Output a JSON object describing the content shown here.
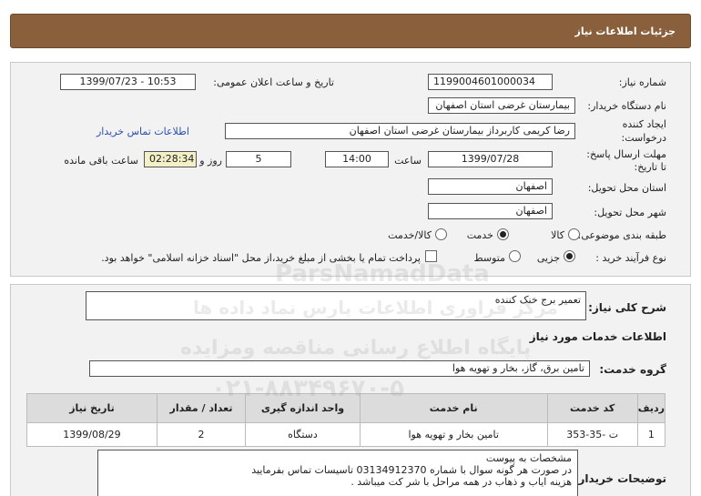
{
  "header": {
    "title": "جزئیات اطلاعات نیاز"
  },
  "form": {
    "need_number_label": "شماره نیاز:",
    "need_number": "1199004601000034",
    "announce_label": "تاریخ و ساعت اعلان عمومی:",
    "announce_value": "1399/07/23 - 10:53",
    "buyer_label": "نام دستگاه خریدار:",
    "buyer_value": "بیمارستان غرضی استان اصفهان",
    "creator_label_1": "ایجاد کننده",
    "creator_label_2": "درخواست:",
    "creator_value": "رضا کریمی کاربرداز بیمارستان غرضی استان اصفهان",
    "contact_link": "اطلاعات تماس خریدار",
    "deadline_label_1": "مهلت ارسال پاسخ:",
    "deadline_label_2": "تا تاریخ:",
    "deadline_date": "1399/07/28",
    "time_label": "ساعت",
    "time_value": "14:00",
    "days_value": "5",
    "days_label": "روز و",
    "remaining_value": "02:28:34",
    "remaining_label": "ساعت باقی مانده",
    "province_label": "استان محل تحویل:",
    "province_value": "اصفهان",
    "city_label": "شهر محل تحویل:",
    "city_value": "اصفهان",
    "category_label": "طبقه بندی موضوعی:",
    "category_options": [
      "کالا",
      "خدمت",
      "کالا/خدمت"
    ],
    "category_selected": "خدمت",
    "process_label": "نوع فرآیند خرید :",
    "process_options": [
      "جزیی",
      "متوسط"
    ],
    "process_selected": "جزیی",
    "payment_note": "پرداخت تمام یا بخشی از مبلغ خرید،از محل \"اسناد خزانه اسلامی\" خواهد بود."
  },
  "summary": {
    "label": "شرح کلی نیاز:",
    "value": "تعمیر برج خنک کننده"
  },
  "services": {
    "section_title": "اطلاعات خدمات مورد نیاز",
    "group_label": "گروه خدمت:",
    "group_value": "تامین برق، گاز، بخار و تهویه هوا",
    "columns": [
      "ردیف",
      "کد خدمت",
      "نام خدمت",
      "واحد اندازه گیری",
      "تعداد / مقدار",
      "تاریخ نیاز"
    ],
    "rows": [
      {
        "row": "1",
        "code": "ت -35-353",
        "name": "تامین بخار و تهویه هوا",
        "unit": "دستگاه",
        "qty": "2",
        "date": "1399/08/29"
      }
    ]
  },
  "buyer_notes": {
    "label": "توضیحات خریدار:",
    "line1": "مشخصات به پیوست",
    "line2": "در صورت هر گونه سوال با شماره 03134912370 تاسیسات تماس بفرمایید",
    "line3": "هزینه ایاب و ذهاب در همه مراحل با شر کت میباشد ."
  },
  "watermark": {
    "line1": "ParsNamadData",
    "line2": "مرکز فراوری اطلاعات پارس نماد داده ها",
    "line3": "پایگاه اطلاع رسانی مناقصه ومزایده",
    "line4": "۰۲۱-۸۸۳۴۹۶۷۰-۵"
  }
}
